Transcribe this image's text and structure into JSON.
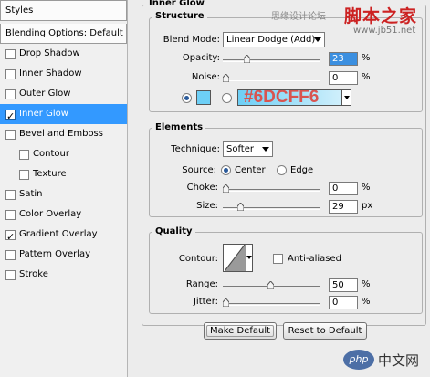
{
  "styles_panel": {
    "header": "Styles",
    "blending_options": "Blending Options: Default",
    "items": [
      {
        "label": "Drop Shadow",
        "checked": false,
        "indent": false
      },
      {
        "label": "Inner Shadow",
        "checked": false,
        "indent": false
      },
      {
        "label": "Outer Glow",
        "checked": false,
        "indent": false
      },
      {
        "label": "Inner Glow",
        "checked": true,
        "indent": false,
        "selected": true
      },
      {
        "label": "Bevel and Emboss",
        "checked": false,
        "indent": false
      },
      {
        "label": "Contour",
        "checked": false,
        "indent": true
      },
      {
        "label": "Texture",
        "checked": false,
        "indent": true
      },
      {
        "label": "Satin",
        "checked": false,
        "indent": false
      },
      {
        "label": "Color Overlay",
        "checked": false,
        "indent": false
      },
      {
        "label": "Gradient Overlay",
        "checked": true,
        "indent": false
      },
      {
        "label": "Pattern Overlay",
        "checked": false,
        "indent": false
      },
      {
        "label": "Stroke",
        "checked": false,
        "indent": false
      }
    ],
    "selection_color": "#3399ff"
  },
  "inner_glow": {
    "title": "Inner Glow",
    "structure": {
      "title": "Structure",
      "blend_mode_label": "Blend Mode:",
      "blend_mode_value": "Linear Dodge (Add)",
      "opacity_label": "Opacity:",
      "opacity_value": "23",
      "opacity_unit": "%",
      "opacity_level": 0.23,
      "noise_label": "Noise:",
      "noise_value": "0",
      "noise_unit": "%",
      "glow_color": "#6DCFF6",
      "glow_color_text": "#6DCFF6"
    },
    "elements": {
      "title": "Elements",
      "technique_label": "Technique:",
      "technique_value": "Softer",
      "source_label": "Source:",
      "source_center": "Center",
      "source_edge": "Edge",
      "choke_label": "Choke:",
      "choke_value": "0",
      "choke_unit": "%",
      "size_label": "Size:",
      "size_value": "29",
      "size_unit": "px"
    },
    "quality": {
      "title": "Quality",
      "contour_label": "Contour:",
      "anti_aliased_label": "Anti-aliased",
      "range_label": "Range:",
      "range_value": "50",
      "range_unit": "%",
      "jitter_label": "Jitter:",
      "jitter_value": "0",
      "jitter_unit": "%"
    },
    "make_default_label": "Make Default",
    "reset_default_label": "Reset to Default"
  },
  "watermarks": {
    "top_gray": "思缘设计论坛",
    "top_red": "脚本之家",
    "url": "www.jb51.net",
    "php_label": "中文网"
  }
}
